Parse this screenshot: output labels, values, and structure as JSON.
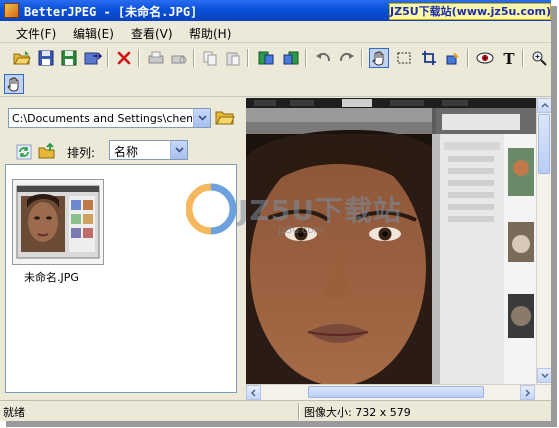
{
  "window": {
    "title": "BetterJPEG - [未命名.JPG]",
    "badge": "JZ5U下载站(www.jz5u.com)"
  },
  "menu": {
    "items": [
      "文件(F)",
      "编辑(E)",
      "查看(V)",
      "帮助(H)"
    ]
  },
  "toolbar": {
    "icons": [
      "open-folder-icon",
      "save-icon",
      "save-as-icon",
      "export-icon",
      "delete-icon",
      "print-icon",
      "print-preview-icon",
      "copy-icon",
      "paste-icon",
      "rotate-left-icon",
      "rotate-right-icon",
      "undo-icon",
      "redo-icon",
      "hand-tool-icon",
      "select-rect-icon",
      "crop-icon",
      "replace-icon",
      "red-eye-icon",
      "text-tool-icon",
      "zoom-icon"
    ],
    "active_tool": "hand-tool-icon"
  },
  "browser": {
    "path": "C:\\Documents and Settings\\chen\\My",
    "sort_label": "排列:",
    "sort_value": "名称",
    "files": [
      {
        "name": "未命名.JPG"
      }
    ]
  },
  "watermark": {
    "brand": "JZ5U下载站",
    "url": "jz5u.com"
  },
  "status": {
    "left": "就绪",
    "right": "图像大小:  732 x 579"
  },
  "colors": {
    "titlebar": "#0a4ecf",
    "window_bg": "#ece9d8",
    "badge_bg": "#fff8a8",
    "delete_red": "#d01414"
  }
}
